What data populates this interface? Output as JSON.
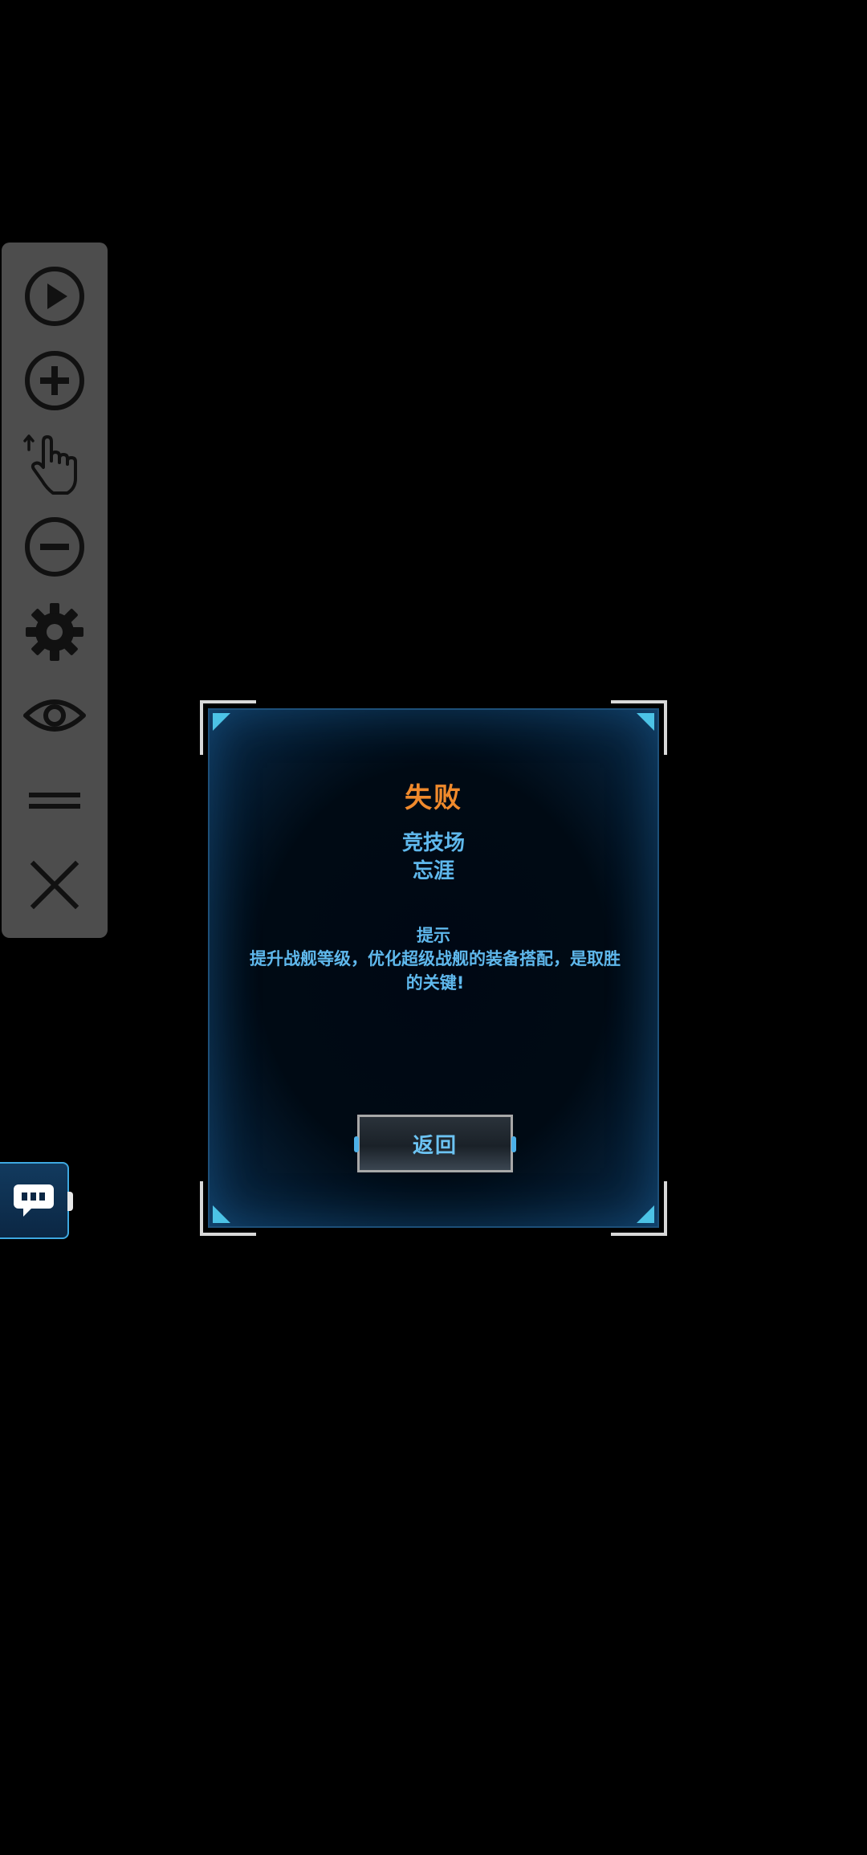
{
  "toolbar": {
    "buttons": [
      {
        "name": "play-button",
        "icon": "play-circle-icon"
      },
      {
        "name": "zoom-in-button",
        "icon": "plus-circle-icon"
      },
      {
        "name": "tap-gesture-button",
        "icon": "hand-pointer-icon"
      },
      {
        "name": "zoom-out-button",
        "icon": "minus-circle-icon"
      },
      {
        "name": "settings-button",
        "icon": "gear-icon"
      },
      {
        "name": "view-button",
        "icon": "eye-icon"
      },
      {
        "name": "menu-button",
        "icon": "equals-icon"
      },
      {
        "name": "close-button",
        "icon": "close-icon"
      }
    ],
    "color": "#4d4d4d",
    "icon_color": "#111111"
  },
  "chat": {
    "icon": "chat-bubble-icon"
  },
  "dialog": {
    "result_title": "失败",
    "mode": "竞技场",
    "opponent": "忘涯",
    "tip_label": "提示",
    "tip_text": "提升战舰等级，优化超级战舰的装备搭配，是取胜的关键!",
    "return_label": "返回",
    "colors": {
      "title": "#f08a2c",
      "text": "#5fb8ec",
      "accent": "#4cc3e6"
    }
  }
}
